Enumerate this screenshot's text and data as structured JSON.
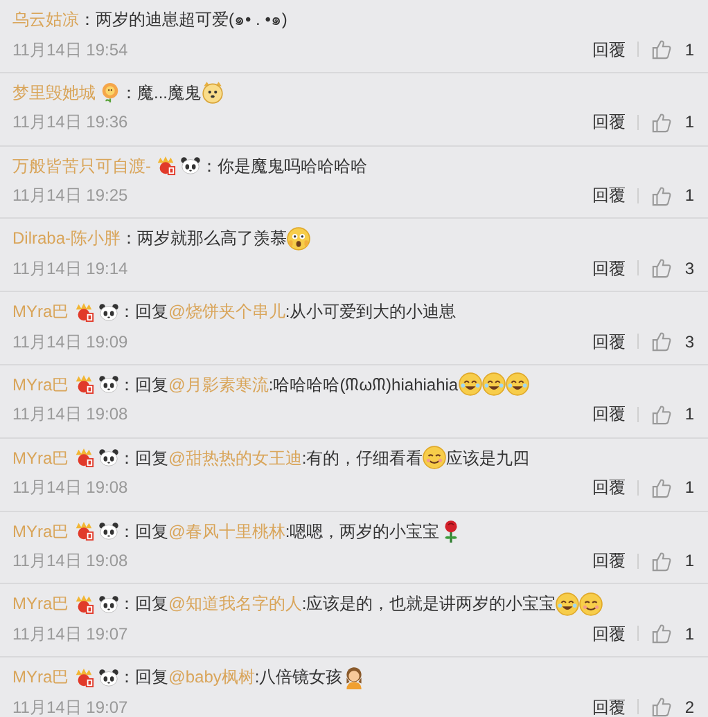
{
  "comments": [
    {
      "user": "乌云姑凉",
      "content": [
        {
          "kind": "text",
          "text": "：两岁的迪崽超可爱(๑• . •๑)"
        }
      ],
      "time": "11月14日 19:54",
      "reply": "回覆",
      "likes": "1"
    },
    {
      "user": "梦里毁她城",
      "badges": [
        {
          "kind": "flower"
        }
      ],
      "content": [
        {
          "kind": "text",
          "text": "：魔...魔鬼"
        },
        {
          "kind": "emoji_dog"
        }
      ],
      "time": "11月14日 19:36",
      "reply": "回覆",
      "likes": "1"
    },
    {
      "user": "万般皆苦只可自渡-",
      "badges": [
        {
          "kind": "medal"
        },
        {
          "kind": "panda"
        }
      ],
      "content": [
        {
          "kind": "text",
          "text": "：你是魔鬼吗哈哈哈哈"
        }
      ],
      "time": "11月14日 19:25",
      "reply": "回覆",
      "likes": "1"
    },
    {
      "user": "Dilraba-陈小胖",
      "content": [
        {
          "kind": "text",
          "text": "：两岁就那么高了羡慕"
        },
        {
          "kind": "emoji_shock"
        }
      ],
      "time": "11月14日 19:14",
      "reply": "回覆",
      "likes": "3"
    },
    {
      "user": "MYra巴",
      "badges": [
        {
          "kind": "medal"
        },
        {
          "kind": "panda"
        }
      ],
      "content": [
        {
          "kind": "text",
          "text": "：回复"
        },
        {
          "kind": "mention",
          "text": "@烧饼夹个串儿"
        },
        {
          "kind": "text",
          "text": ":从小可爱到大的小迪崽"
        }
      ],
      "time": "11月14日 19:09",
      "reply": "回覆",
      "likes": "3"
    },
    {
      "user": "MYra巴",
      "badges": [
        {
          "kind": "medal"
        },
        {
          "kind": "panda"
        }
      ],
      "content": [
        {
          "kind": "text",
          "text": "：回复"
        },
        {
          "kind": "mention",
          "text": "@月影素寒流"
        },
        {
          "kind": "text",
          "text": ":哈哈哈哈(ᙏωᙏ)hiahiahia"
        },
        {
          "kind": "emoji_laugh"
        },
        {
          "kind": "emoji_laugh"
        },
        {
          "kind": "emoji_laugh"
        }
      ],
      "time": "11月14日 19:08",
      "reply": "回覆",
      "likes": "1"
    },
    {
      "user": "MYra巴",
      "badges": [
        {
          "kind": "medal"
        },
        {
          "kind": "panda"
        }
      ],
      "content": [
        {
          "kind": "text",
          "text": "：回复"
        },
        {
          "kind": "mention",
          "text": "@甜热热的女王迪"
        },
        {
          "kind": "text",
          "text": ":有的，仔细看看"
        },
        {
          "kind": "emoji_smile"
        },
        {
          "kind": "text",
          "text": "应该是九四"
        }
      ],
      "time": "11月14日 19:08",
      "reply": "回覆",
      "likes": "1"
    },
    {
      "user": "MYra巴",
      "badges": [
        {
          "kind": "medal"
        },
        {
          "kind": "panda"
        }
      ],
      "content": [
        {
          "kind": "text",
          "text": "：回复"
        },
        {
          "kind": "mention",
          "text": "@春风十里桃林"
        },
        {
          "kind": "text",
          "text": ":嗯嗯，两岁的小宝宝"
        },
        {
          "kind": "emoji_rose"
        }
      ],
      "time": "11月14日 19:08",
      "reply": "回覆",
      "likes": "1"
    },
    {
      "user": "MYra巴",
      "badges": [
        {
          "kind": "medal"
        },
        {
          "kind": "panda"
        }
      ],
      "content": [
        {
          "kind": "text",
          "text": "：回复"
        },
        {
          "kind": "mention",
          "text": "@知道我名字的人"
        },
        {
          "kind": "text",
          "text": ":应该是的，也就是讲两岁的小宝宝"
        },
        {
          "kind": "emoji_laugh"
        },
        {
          "kind": "emoji_smile"
        }
      ],
      "time": "11月14日 19:07",
      "reply": "回覆",
      "likes": "1"
    },
    {
      "user": "MYra巴",
      "badges": [
        {
          "kind": "medal"
        },
        {
          "kind": "panda"
        }
      ],
      "content": [
        {
          "kind": "text",
          "text": "：回复"
        },
        {
          "kind": "mention",
          "text": "@baby枫树"
        },
        {
          "kind": "text",
          "text": ":八倍镜女孩"
        },
        {
          "kind": "emoji_girl"
        }
      ],
      "time": "11月14日 19:07",
      "reply": "回覆",
      "likes": "2"
    }
  ]
}
